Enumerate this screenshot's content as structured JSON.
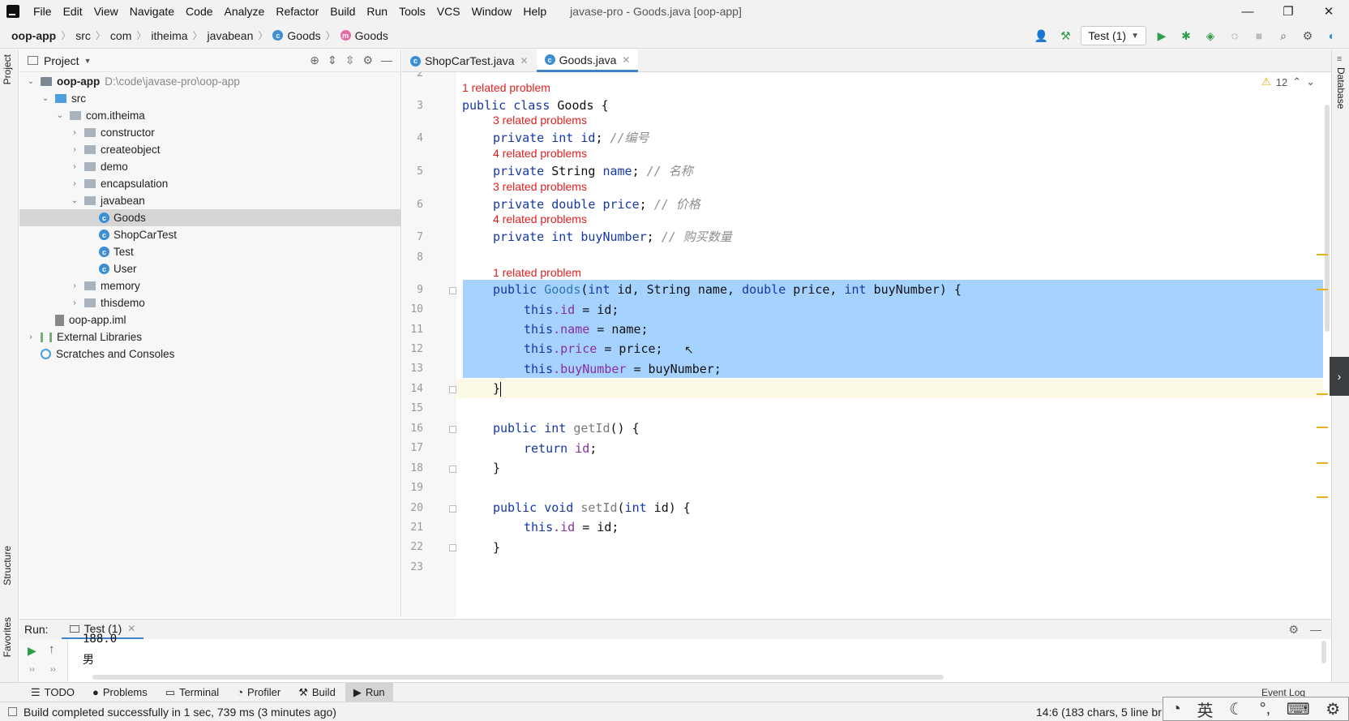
{
  "menu": [
    "File",
    "Edit",
    "View",
    "Navigate",
    "Code",
    "Analyze",
    "Refactor",
    "Build",
    "Run",
    "Tools",
    "VCS",
    "Window",
    "Help"
  ],
  "window_title": "javase-pro - Goods.java [oop-app]",
  "window_controls": {
    "minimize": "—",
    "restore": "❐",
    "close": "✕"
  },
  "breadcrumbs": [
    "oop-app",
    "src",
    "com",
    "itheima",
    "javabean",
    "Goods",
    "Goods"
  ],
  "run_config": "Test (1)",
  "project_panel": {
    "title": "Project",
    "tree": [
      {
        "label": "oop-app",
        "hint": "D:\\code\\javase-pro\\oop-app"
      },
      {
        "label": "src"
      },
      {
        "label": "com.itheima"
      },
      {
        "label": "constructor"
      },
      {
        "label": "createobject"
      },
      {
        "label": "demo"
      },
      {
        "label": "encapsulation"
      },
      {
        "label": "javabean"
      },
      {
        "label": "Goods"
      },
      {
        "label": "ShopCarTest"
      },
      {
        "label": "Test"
      },
      {
        "label": "User"
      },
      {
        "label": "memory"
      },
      {
        "label": "thisdemo"
      },
      {
        "label": "oop-app.iml"
      },
      {
        "label": "External Libraries"
      },
      {
        "label": "Scratches and Consoles"
      }
    ]
  },
  "editor_tabs": [
    "ShopCarTest.java",
    "Goods.java"
  ],
  "warnings": {
    "count": "12"
  },
  "line_numbers": [
    "2",
    "3",
    "4",
    "5",
    "6",
    "7",
    "8",
    "9",
    "10",
    "11",
    "12",
    "13",
    "14",
    "15",
    "16",
    "17",
    "18",
    "19",
    "20",
    "21",
    "22",
    "23"
  ],
  "problems": {
    "p1": "1 related problem",
    "p3": "3 related problems",
    "p4": "4 related problems",
    "p5": "3 related problems",
    "p6": "4 related problems",
    "p9": "1 related problem"
  },
  "code": {
    "l3": {
      "kw": "public class",
      "rest": " Goods {"
    },
    "l4": {
      "kw": "private int",
      "field": " id",
      "rest": "; ",
      "comment": "//编号"
    },
    "l5": {
      "kw": "private",
      "rest": " String ",
      "field": "name",
      "rest2": "; ",
      "comment": "// 名称"
    },
    "l6": {
      "kw": "private double",
      "field": " price",
      "rest": "; ",
      "comment": "// 价格"
    },
    "l7": {
      "kw": "private int",
      "field": " buyNumber",
      "rest": "; ",
      "comment": "// 购买数量"
    },
    "l9": {
      "kw": "public",
      "ctor": " Goods",
      "rest": "(",
      "kw2": "int",
      "rest2": " id, String name, ",
      "kw3": "double",
      "rest3": " price, ",
      "kw4": "int",
      "rest4": " buyNumber) {"
    },
    "l10": {
      "kw": "this",
      "field": ".id",
      "rest": " = id;"
    },
    "l11": {
      "kw": "this",
      "field": ".name",
      "rest": " = name;"
    },
    "l12": {
      "kw": "this",
      "field": ".price",
      "rest": " = price;"
    },
    "l13": {
      "kw": "this",
      "field": ".buyNumber",
      "rest": " = buyNumber;"
    },
    "l14": {
      "rest": "}"
    },
    "l16": {
      "kw": "public int",
      "fn": " getId",
      "rest": "() {"
    },
    "l17": {
      "kw": "return",
      "field": " id",
      "rest": ";"
    },
    "l18": {
      "rest": "}"
    },
    "l20": {
      "kw": "public void",
      "fn": " setId",
      "rest": "(",
      "kw2": "int",
      "rest2": " id) {"
    },
    "l21": {
      "kw": "this",
      "field": ".id",
      "rest": " = id;"
    },
    "l22": {
      "rest": "}"
    }
  },
  "run_panel": {
    "label": "Run:",
    "tab": "Test (1)",
    "output": [
      "188.0",
      "男"
    ]
  },
  "left_stripe": {
    "project": "Project",
    "structure": "Structure",
    "favorites": "Favorites"
  },
  "right_stripe": {
    "database": "Database"
  },
  "tool_strip": [
    "TODO",
    "Problems",
    "Terminal",
    "Profiler",
    "Build",
    "Run"
  ],
  "event_log": "Event Log",
  "status": {
    "message": "Build completed successfully in 1 sec, 739 ms (3 minutes ago)",
    "position": "14:6 (183 chars, 5 line br"
  },
  "ime": [
    "英"
  ],
  "colors": {
    "selection": "#a6d2ff",
    "accent": "#4083c9",
    "keyword": "#1538a8",
    "field": "#8a2ea3",
    "problem": "#e02020"
  }
}
